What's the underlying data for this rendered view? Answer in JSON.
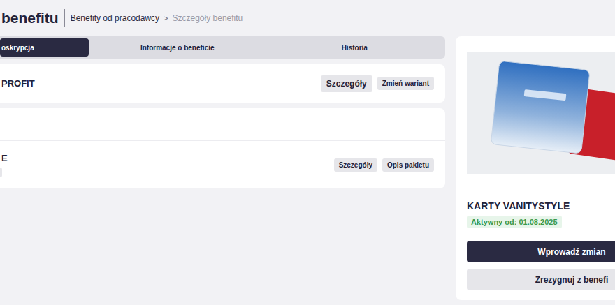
{
  "brand": "benefitu",
  "breadcrumb": {
    "link": "Benefity od pracodawcy",
    "separator": ">",
    "current": "Szczegóły benefitu"
  },
  "tabs": [
    {
      "label": "oskrypcja",
      "selected": true
    },
    {
      "label": "Informacje o beneficie",
      "selected": false
    },
    {
      "label": "Historia",
      "selected": false
    }
  ],
  "variant_card": {
    "title": "PROFIT",
    "buttons": [
      "Szczegóły",
      "Zmień wariant"
    ]
  },
  "package_card": {
    "title": "E",
    "buttons": [
      "Szczegóły",
      "Opis pakietu"
    ]
  },
  "benefit": {
    "name": "KARTY VANITYSTYLE",
    "status": "Aktywny od: 01.08.2025",
    "actions": [
      "Wprowadź zmian",
      "Zrezygnuj z benefi"
    ]
  }
}
